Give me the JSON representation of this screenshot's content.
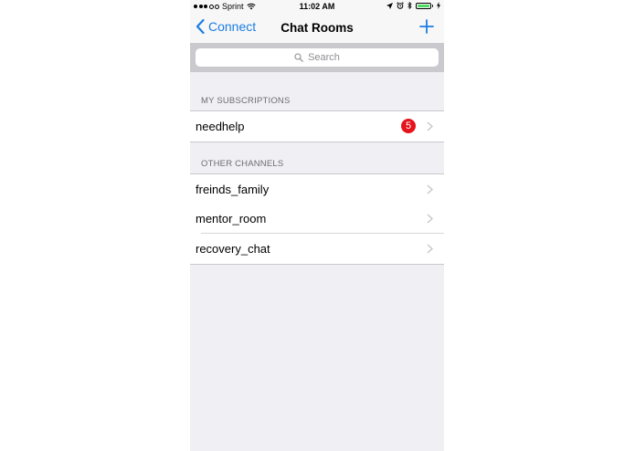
{
  "status_bar": {
    "carrier": "Sprint",
    "time": "11:02 AM",
    "icons": [
      "signal-dots-icon",
      "wifi-icon",
      "location-arrow-icon",
      "alarm-icon",
      "bluetooth-icon",
      "battery-icon",
      "charging-bolt-icon"
    ]
  },
  "nav": {
    "back_label": "Connect",
    "title": "Chat Rooms",
    "add_icon": "plus-icon"
  },
  "search": {
    "placeholder": "Search"
  },
  "sections": {
    "subscriptions_header": "MY SUBSCRIPTIONS",
    "subscriptions": [
      {
        "label": "needhelp",
        "badge": "5"
      }
    ],
    "channels_header": "OTHER CHANNELS",
    "channels": [
      {
        "label": "freinds_family"
      },
      {
        "label": "mentor_room"
      },
      {
        "label": "recovery_chat"
      }
    ]
  },
  "colors": {
    "accent": "#1a7ee3",
    "badge": "#e3141b",
    "background": "#efeff4",
    "battery": "#4cd964"
  }
}
